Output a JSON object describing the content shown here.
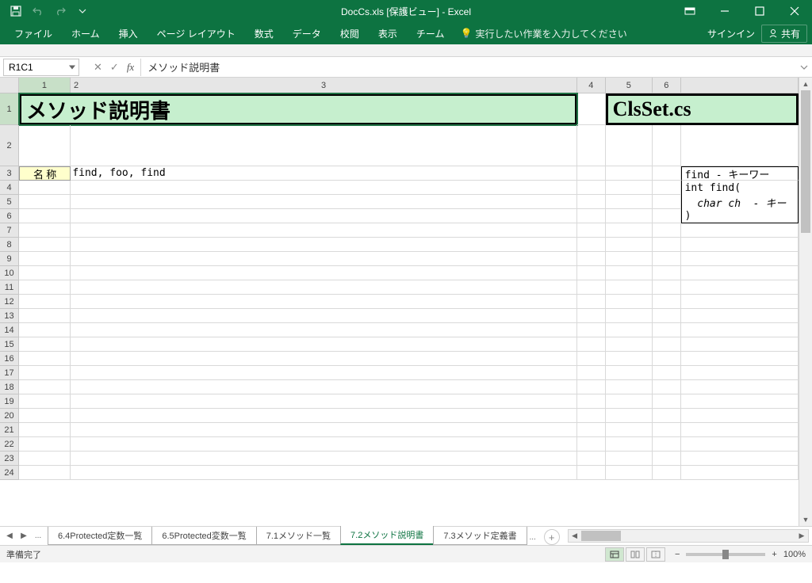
{
  "titlebar": {
    "title": "DocCs.xls [保護ビュー] - Excel"
  },
  "ribbon": {
    "tabs": [
      "ファイル",
      "ホーム",
      "挿入",
      "ページ レイアウト",
      "数式",
      "データ",
      "校閲",
      "表示",
      "チーム"
    ],
    "tell_me": "実行したい作業を入力してください",
    "signin": "サインイン",
    "share": "共有"
  },
  "formula": {
    "name_box": "R1C1",
    "value": "メソッド説明書"
  },
  "columns": [
    "1",
    "2",
    "3",
    "4",
    "5",
    "6"
  ],
  "cells": {
    "r1c1": "メソッド説明書",
    "r1c5": "ClsSet.cs",
    "r3c1": "名 称",
    "r3c2": "find, foo, find",
    "r3c6": "find - キーワー",
    "r4c6": "int find(",
    "r5c6": "  char ch  - キー",
    "r6c6": ")"
  },
  "sheet_tabs": {
    "tabs": [
      "6.4Protected定数一覧",
      "6.5Protected変数一覧",
      "7.1メソッド一覧",
      "7.2メソッド説明書",
      "7.3メソッド定義書"
    ],
    "active_index": 3,
    "more": "..."
  },
  "status": {
    "ready": "準備完了",
    "zoom": "100%"
  }
}
